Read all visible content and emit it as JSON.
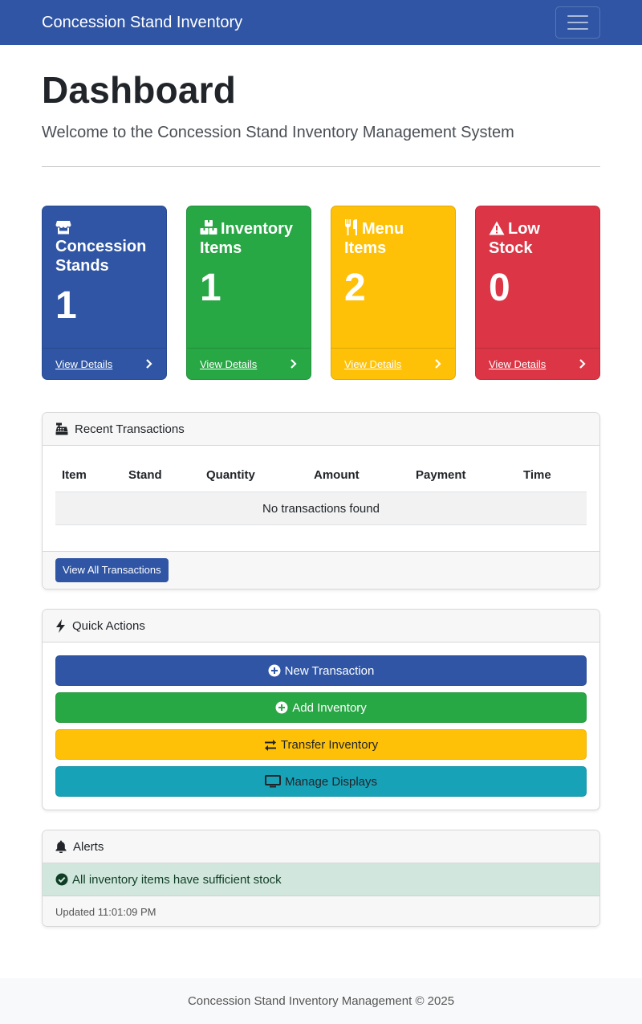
{
  "navbar": {
    "brand": "Concession Stand Inventory",
    "toggler_icon": "hamburger-icon"
  },
  "header": {
    "title": "Dashboard",
    "subtitle": "Welcome to the Concession Stand Inventory Management System"
  },
  "stats": [
    {
      "title": "Concession Stands",
      "value": "1",
      "link": "View Details",
      "icon": "store-icon",
      "color": "#2f55a4"
    },
    {
      "title": "Inventory Items",
      "value": "1",
      "link": "View Details",
      "icon": "boxes-icon",
      "color": "#28a745"
    },
    {
      "title": "Menu Items",
      "value": "2",
      "link": "View Details",
      "icon": "utensils-icon",
      "color": "#ffc107"
    },
    {
      "title": "Low Stock",
      "value": "0",
      "link": "View Details",
      "icon": "warning-icon",
      "color": "#dc3545"
    }
  ],
  "transactions": {
    "title": "Recent Transactions",
    "columns": [
      "Item",
      "Stand",
      "Quantity",
      "Amount",
      "Payment",
      "Time"
    ],
    "empty_message": "No transactions found",
    "view_all": "View All Transactions"
  },
  "quick_actions": {
    "title": "Quick Actions",
    "buttons": [
      {
        "label": "New Transaction",
        "icon": "plus-circle-icon",
        "color": "#2f55a4"
      },
      {
        "label": "Add Inventory",
        "icon": "plus-circle-icon",
        "color": "#28a745"
      },
      {
        "label": "Transfer Inventory",
        "icon": "exchange-icon",
        "color": "#ffc107"
      },
      {
        "label": "Manage Displays",
        "icon": "monitor-icon",
        "color": "#17a2b8"
      }
    ]
  },
  "alerts": {
    "title": "Alerts",
    "message": "All inventory items have sufficient stock",
    "updated": "Updated 11:01:09 PM"
  },
  "footer": {
    "text": "Concession Stand Inventory Management © 2025"
  }
}
